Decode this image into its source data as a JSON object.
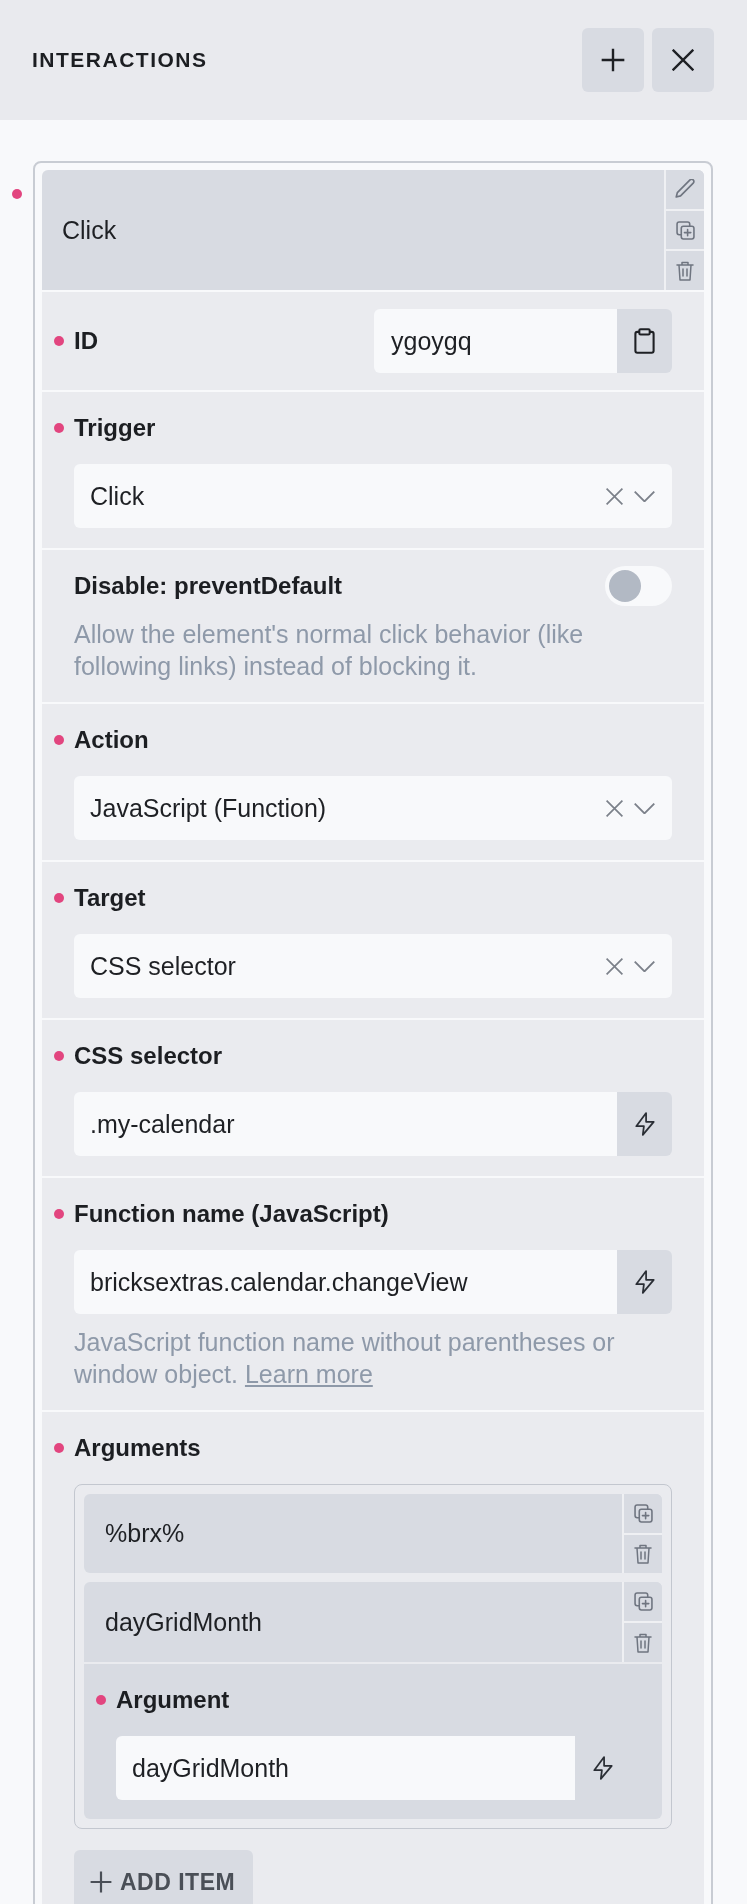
{
  "panel": {
    "title": "INTERACTIONS"
  },
  "interactions": [
    {
      "title": "Click",
      "has_value": true,
      "expanded": true,
      "fields": [
        {
          "kind": "text_copy",
          "label": "ID",
          "has_value": true,
          "value": "ygoygq"
        },
        {
          "kind": "select",
          "label": "Trigger",
          "has_value": true,
          "value": "Click"
        },
        {
          "kind": "toggle",
          "label": "Disable: preventDefault",
          "has_value": false,
          "on": false,
          "description": "Allow the element's normal click behavior (like following links) instead of blocking it."
        },
        {
          "kind": "select",
          "label": "Action",
          "has_value": true,
          "value": "JavaScript (Function)"
        },
        {
          "kind": "select",
          "label": "Target",
          "has_value": true,
          "value": "CSS selector"
        },
        {
          "kind": "text_dynamic",
          "label": "CSS selector",
          "has_value": true,
          "value": ".my-calendar"
        },
        {
          "kind": "text_dynamic",
          "label": "Function name (JavaScript)",
          "has_value": true,
          "value": "bricksextras.calendar.changeView",
          "description": "JavaScript function name without parentheses or window object.",
          "link": "Learn more"
        },
        {
          "kind": "repeater",
          "label": "Arguments",
          "has_value": true,
          "add_label": "ADD ITEM",
          "items": [
            {
              "title": "%brx%",
              "expanded": false
            },
            {
              "title": "dayGridMonth",
              "expanded": true,
              "fields": [
                {
                  "kind": "text_dynamic",
                  "label": "Argument",
                  "has_value": true,
                  "value": "dayGridMonth"
                }
              ]
            }
          ]
        }
      ]
    }
  ]
}
